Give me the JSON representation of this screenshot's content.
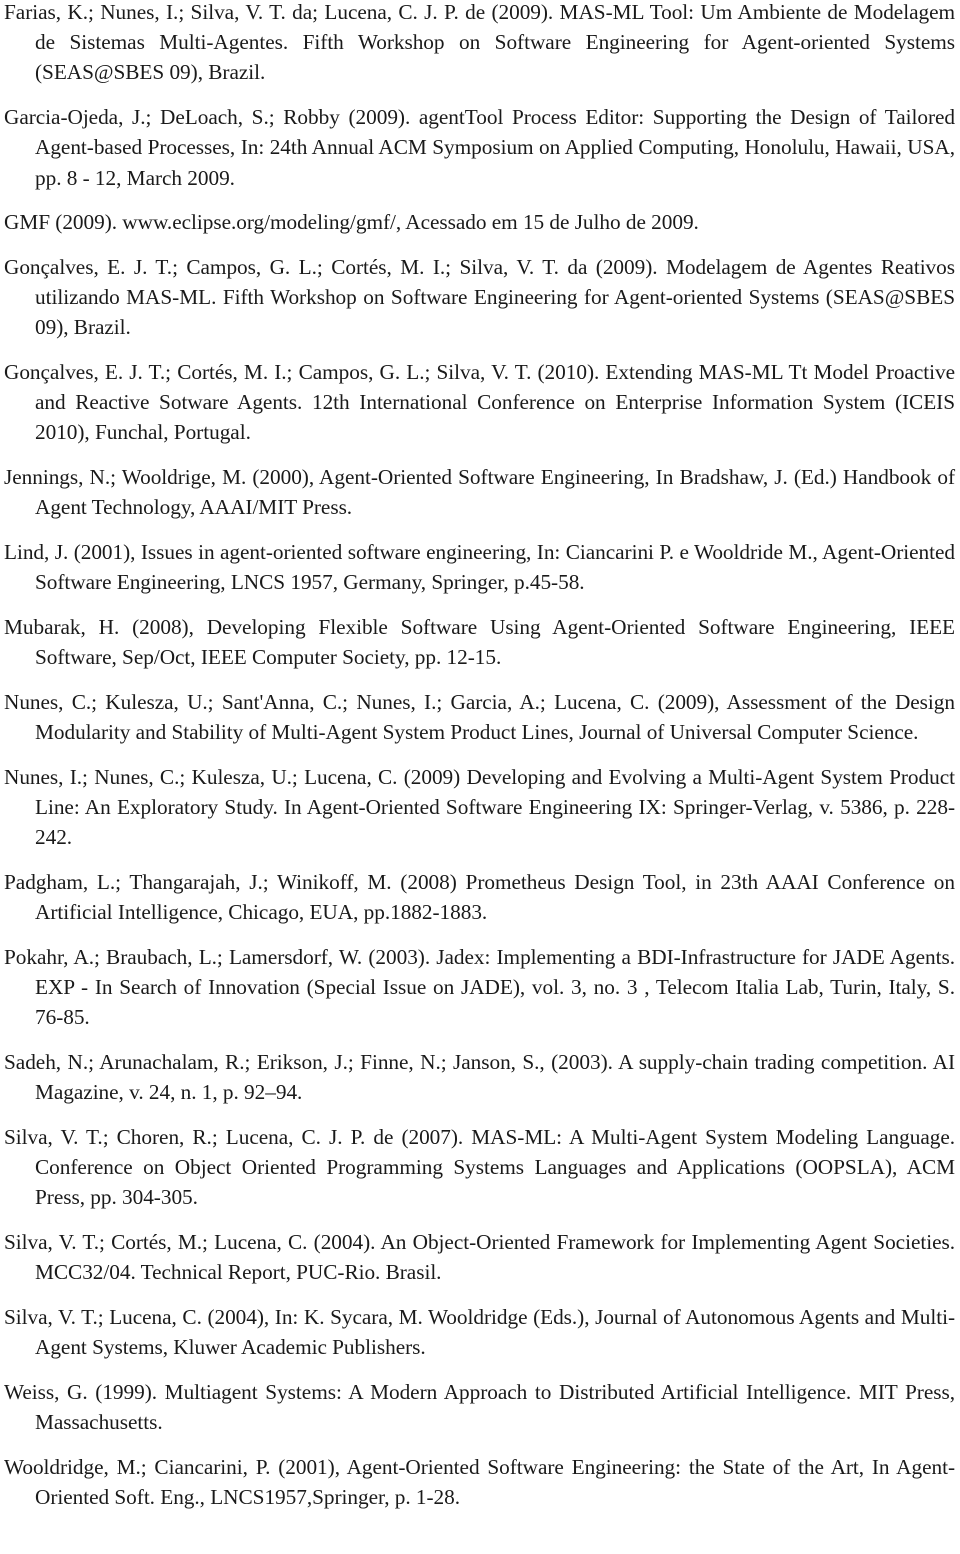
{
  "references": [
    "Farias, K.; Nunes, I.; Silva, V. T. da; Lucena, C. J. P. de (2009). MAS-ML Tool: Um Ambiente de Modelagem de Sistemas Multi-Agentes. Fifth Workshop on Software Engineering for Agent-oriented Systems (SEAS@SBES 09), Brazil.",
    "Garcia-Ojeda, J.; DeLoach, S.; Robby (2009). agentTool Process Editor: Supporting the Design of Tailored Agent-based Processes, In: 24th Annual ACM Symposium on Applied Computing, Honolulu, Hawaii, USA, pp. 8 - 12, March 2009.",
    "GMF (2009). www.eclipse.org/modeling/gmf/, Acessado em 15 de Julho de 2009.",
    "Gonçalves, E. J. T.; Campos, G. L.; Cortés, M. I.; Silva, V. T. da (2009). Modelagem de Agentes Reativos utilizando MAS-ML. Fifth Workshop on Software Engineering for Agent-oriented Systems (SEAS@SBES 09), Brazil.",
    "Gonçalves, E. J. T.; Cortés, M. I.; Campos, G. L.; Silva, V. T. (2010). Extending MAS-ML Tt Model Proactive and Reactive Sotware Agents. 12th International Conference on Enterprise Information System (ICEIS 2010), Funchal, Portugal.",
    "Jennings, N.; Wooldrige, M. (2000), Agent-Oriented Software Engineering, In Bradshaw, J. (Ed.) Handbook of Agent Technology, AAAI/MIT Press.",
    "Lind, J. (2001), Issues in agent-oriented software engineering, In: Ciancarini P. e Wooldride M., Agent-Oriented Software Engineering, LNCS 1957, Germany, Springer, p.45-58.",
    "Mubarak, H. (2008), Developing Flexible Software Using Agent-Oriented Software Engineering, IEEE Software, Sep/Oct, IEEE Computer Society, pp. 12-15.",
    "Nunes, C.; Kulesza, U.; Sant'Anna, C.; Nunes, I.; Garcia, A.; Lucena, C. (2009), Assessment of the Design Modularity and Stability of Multi-Agent System Product Lines, Journal of Universal Computer Science.",
    "Nunes, I.; Nunes, C.; Kulesza, U.; Lucena, C. (2009) Developing and Evolving a Multi-Agent System Product Line: An Exploratory Study. In Agent-Oriented Software Engineering IX: Springer-Verlag, v. 5386, p. 228-242.",
    "Padgham, L.; Thangarajah, J.; Winikoff, M. (2008) Prometheus Design Tool, in 23th AAAI Conference on Artificial Intelligence, Chicago, EUA, pp.1882-1883.",
    "Pokahr, A.; Braubach, L.; Lamersdorf, W. (2003). Jadex: Implementing a BDI-Infrastructure for JADE Agents. EXP - In Search of Innovation (Special Issue on JADE), vol. 3, no. 3 , Telecom Italia Lab, Turin, Italy, S. 76-85.",
    "Sadeh, N.; Arunachalam, R.; Erikson, J.; Finne, N.; Janson, S., (2003). A supply-chain trading competition. AI Magazine, v. 24, n. 1, p. 92–94.",
    "Silva, V. T.; Choren, R.; Lucena, C. J. P. de (2007). MAS-ML: A Multi-Agent System Modeling Language. Conference on Object Oriented Programming Systems Languages and Applications (OOPSLA), ACM Press, pp. 304-305.",
    "Silva, V. T.; Cortés, M.; Lucena, C. (2004). An Object-Oriented Framework for Implementing Agent Societies. MCC32/04. Technical Report, PUC-Rio. Brasil.",
    "Silva, V. T.; Lucena, C. (2004), In: K. Sycara, M. Wooldridge (Eds.), Journal of Autonomous Agents and Multi-Agent Systems, Kluwer Academic Publishers.",
    "Weiss, G. (1999). Multiagent Systems: A Modern Approach to Distributed Artificial Intelligence. MIT Press, Massachusetts.",
    "Wooldridge, M.; Ciancarini, P. (2001), Agent-Oriented Software Engineering: the State of the Art, In Agent-Oriented Soft. Eng., LNCS1957,Springer, p. 1-28."
  ]
}
